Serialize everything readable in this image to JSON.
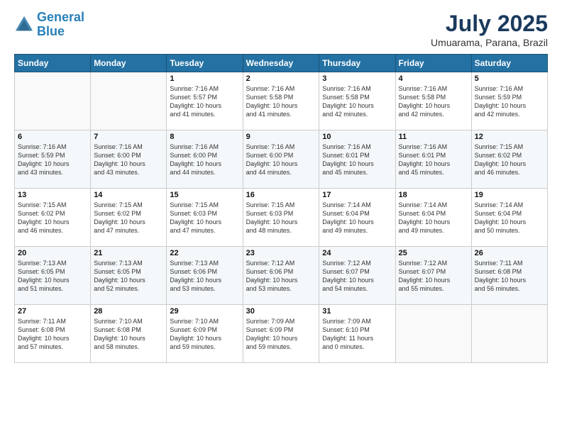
{
  "header": {
    "logo_line1": "General",
    "logo_line2": "Blue",
    "month": "July 2025",
    "location": "Umuarama, Parana, Brazil"
  },
  "weekdays": [
    "Sunday",
    "Monday",
    "Tuesday",
    "Wednesday",
    "Thursday",
    "Friday",
    "Saturday"
  ],
  "weeks": [
    [
      {
        "day": "",
        "info": ""
      },
      {
        "day": "",
        "info": ""
      },
      {
        "day": "1",
        "info": "Sunrise: 7:16 AM\nSunset: 5:57 PM\nDaylight: 10 hours\nand 41 minutes."
      },
      {
        "day": "2",
        "info": "Sunrise: 7:16 AM\nSunset: 5:58 PM\nDaylight: 10 hours\nand 41 minutes."
      },
      {
        "day": "3",
        "info": "Sunrise: 7:16 AM\nSunset: 5:58 PM\nDaylight: 10 hours\nand 42 minutes."
      },
      {
        "day": "4",
        "info": "Sunrise: 7:16 AM\nSunset: 5:58 PM\nDaylight: 10 hours\nand 42 minutes."
      },
      {
        "day": "5",
        "info": "Sunrise: 7:16 AM\nSunset: 5:59 PM\nDaylight: 10 hours\nand 42 minutes."
      }
    ],
    [
      {
        "day": "6",
        "info": "Sunrise: 7:16 AM\nSunset: 5:59 PM\nDaylight: 10 hours\nand 43 minutes."
      },
      {
        "day": "7",
        "info": "Sunrise: 7:16 AM\nSunset: 6:00 PM\nDaylight: 10 hours\nand 43 minutes."
      },
      {
        "day": "8",
        "info": "Sunrise: 7:16 AM\nSunset: 6:00 PM\nDaylight: 10 hours\nand 44 minutes."
      },
      {
        "day": "9",
        "info": "Sunrise: 7:16 AM\nSunset: 6:00 PM\nDaylight: 10 hours\nand 44 minutes."
      },
      {
        "day": "10",
        "info": "Sunrise: 7:16 AM\nSunset: 6:01 PM\nDaylight: 10 hours\nand 45 minutes."
      },
      {
        "day": "11",
        "info": "Sunrise: 7:16 AM\nSunset: 6:01 PM\nDaylight: 10 hours\nand 45 minutes."
      },
      {
        "day": "12",
        "info": "Sunrise: 7:15 AM\nSunset: 6:02 PM\nDaylight: 10 hours\nand 46 minutes."
      }
    ],
    [
      {
        "day": "13",
        "info": "Sunrise: 7:15 AM\nSunset: 6:02 PM\nDaylight: 10 hours\nand 46 minutes."
      },
      {
        "day": "14",
        "info": "Sunrise: 7:15 AM\nSunset: 6:02 PM\nDaylight: 10 hours\nand 47 minutes."
      },
      {
        "day": "15",
        "info": "Sunrise: 7:15 AM\nSunset: 6:03 PM\nDaylight: 10 hours\nand 47 minutes."
      },
      {
        "day": "16",
        "info": "Sunrise: 7:15 AM\nSunset: 6:03 PM\nDaylight: 10 hours\nand 48 minutes."
      },
      {
        "day": "17",
        "info": "Sunrise: 7:14 AM\nSunset: 6:04 PM\nDaylight: 10 hours\nand 49 minutes."
      },
      {
        "day": "18",
        "info": "Sunrise: 7:14 AM\nSunset: 6:04 PM\nDaylight: 10 hours\nand 49 minutes."
      },
      {
        "day": "19",
        "info": "Sunrise: 7:14 AM\nSunset: 6:04 PM\nDaylight: 10 hours\nand 50 minutes."
      }
    ],
    [
      {
        "day": "20",
        "info": "Sunrise: 7:13 AM\nSunset: 6:05 PM\nDaylight: 10 hours\nand 51 minutes."
      },
      {
        "day": "21",
        "info": "Sunrise: 7:13 AM\nSunset: 6:05 PM\nDaylight: 10 hours\nand 52 minutes."
      },
      {
        "day": "22",
        "info": "Sunrise: 7:13 AM\nSunset: 6:06 PM\nDaylight: 10 hours\nand 53 minutes."
      },
      {
        "day": "23",
        "info": "Sunrise: 7:12 AM\nSunset: 6:06 PM\nDaylight: 10 hours\nand 53 minutes."
      },
      {
        "day": "24",
        "info": "Sunrise: 7:12 AM\nSunset: 6:07 PM\nDaylight: 10 hours\nand 54 minutes."
      },
      {
        "day": "25",
        "info": "Sunrise: 7:12 AM\nSunset: 6:07 PM\nDaylight: 10 hours\nand 55 minutes."
      },
      {
        "day": "26",
        "info": "Sunrise: 7:11 AM\nSunset: 6:08 PM\nDaylight: 10 hours\nand 56 minutes."
      }
    ],
    [
      {
        "day": "27",
        "info": "Sunrise: 7:11 AM\nSunset: 6:08 PM\nDaylight: 10 hours\nand 57 minutes."
      },
      {
        "day": "28",
        "info": "Sunrise: 7:10 AM\nSunset: 6:08 PM\nDaylight: 10 hours\nand 58 minutes."
      },
      {
        "day": "29",
        "info": "Sunrise: 7:10 AM\nSunset: 6:09 PM\nDaylight: 10 hours\nand 59 minutes."
      },
      {
        "day": "30",
        "info": "Sunrise: 7:09 AM\nSunset: 6:09 PM\nDaylight: 10 hours\nand 59 minutes."
      },
      {
        "day": "31",
        "info": "Sunrise: 7:09 AM\nSunset: 6:10 PM\nDaylight: 11 hours\nand 0 minutes."
      },
      {
        "day": "",
        "info": ""
      },
      {
        "day": "",
        "info": ""
      }
    ]
  ]
}
